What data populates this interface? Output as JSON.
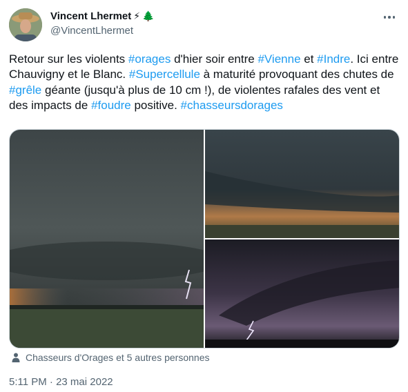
{
  "author": {
    "name": "Vincent Lhermet",
    "name_emoji_1": "⚡",
    "name_emoji_2": "🌲",
    "handle": "@VincentLhermet"
  },
  "tweet": {
    "text_parts": [
      {
        "text": "Retour sur les violents ",
        "tag": false
      },
      {
        "text": "#orages",
        "tag": true
      },
      {
        "text": " d'hier soir entre ",
        "tag": false
      },
      {
        "text": "#Vienne",
        "tag": true
      },
      {
        "text": " et ",
        "tag": false
      },
      {
        "text": "#Indre",
        "tag": true
      },
      {
        "text": ". Ici entre Chauvigny et le Blanc. ",
        "tag": false
      },
      {
        "text": "#Supercellule",
        "tag": true
      },
      {
        "text": " à maturité provoquant des chutes de ",
        "tag": false
      },
      {
        "text": "#grêle",
        "tag": true
      },
      {
        "text": " géante (jusqu'à plus de 10 cm !), de violentes rafales des vent et des impacts de ",
        "tag": false
      },
      {
        "text": "#foudre",
        "tag": true
      },
      {
        "text": " positive. ",
        "tag": false
      },
      {
        "text": "#chasseursdorages",
        "tag": true
      }
    ],
    "tagged_people": "Chasseurs d'Orages et 5 autres personnes",
    "timestamp": "5:11 PM · 23 mai 2022"
  },
  "colors": {
    "link": "#1d9bf0",
    "secondary_text": "#536471",
    "primary_text": "#0f1419"
  },
  "icons": {
    "more": "more-horizontal-icon",
    "tagged": "person-icon"
  }
}
